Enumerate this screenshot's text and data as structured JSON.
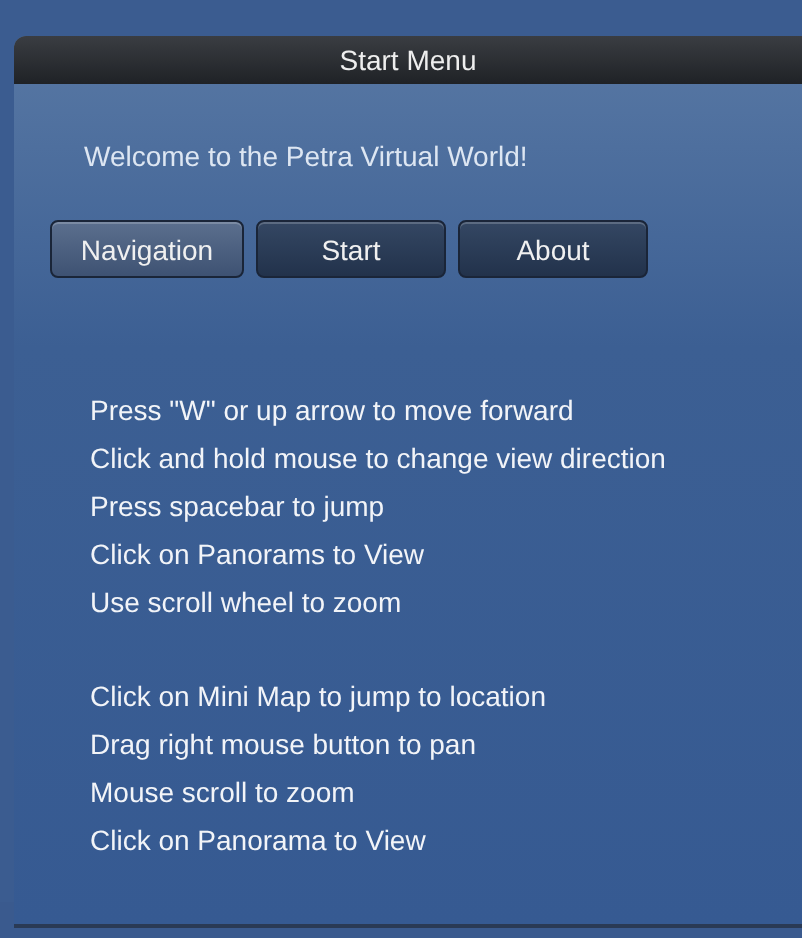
{
  "window": {
    "title": "Start Menu"
  },
  "welcome": "Welcome to the Petra Virtual World!",
  "tabs": [
    {
      "label": "Navigation",
      "selected": true
    },
    {
      "label": "Start",
      "selected": false
    },
    {
      "label": "About",
      "selected": false
    }
  ],
  "instruction_groups": [
    [
      "Press \"W\" or up arrow to move forward",
      "Click and hold mouse to change view direction",
      "Press spacebar to jump",
      "Click on Panorams to View",
      "Use scroll wheel to zoom"
    ],
    [
      "Click on Mini Map to jump to location",
      "Drag right mouse button to pan",
      "Mouse scroll to zoom",
      "Click on Panorama to View"
    ]
  ]
}
